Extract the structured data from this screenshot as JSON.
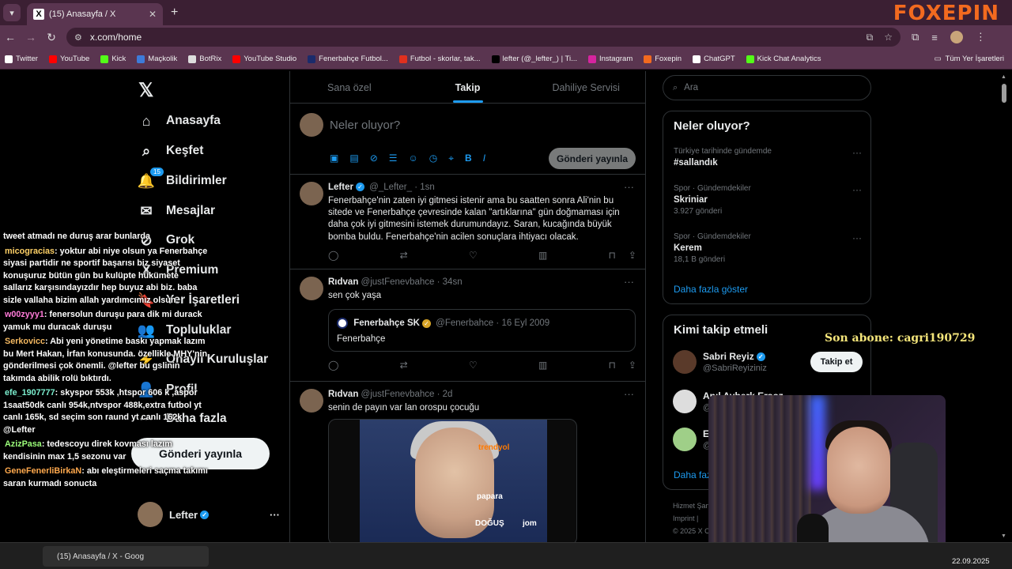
{
  "browser": {
    "tab_title": "(15) Anasayfa / X",
    "tab_close": "✕",
    "new_tab": "+",
    "url": "x.com/home",
    "brand": "FOXEPIN"
  },
  "bookmarks": [
    {
      "label": "Twitter",
      "color": "#ffffff"
    },
    {
      "label": "YouTube",
      "color": "#ff0000"
    },
    {
      "label": "Kick",
      "color": "#53fc18"
    },
    {
      "label": "Maçkolik",
      "color": "#3d7bd9"
    },
    {
      "label": "BotRix",
      "color": "#dddddd"
    },
    {
      "label": "YouTube Studio",
      "color": "#ff0000"
    },
    {
      "label": "Fenerbahçe Futbol...",
      "color": "#1b2b6b"
    },
    {
      "label": "Futbol - skorlar, tak...",
      "color": "#e0301e"
    },
    {
      "label": "lefter (@_lefter_) | Ti...",
      "color": "#000000"
    },
    {
      "label": "Instagram",
      "color": "#d6249f"
    },
    {
      "label": "Foxepin",
      "color": "#f26a1f"
    },
    {
      "label": "ChatGPT",
      "color": "#ffffff"
    },
    {
      "label": "Kick Chat Analytics",
      "color": "#53fc18"
    }
  ],
  "bookmarks_all": "Tüm Yer İşaretleri",
  "nav": {
    "items": [
      {
        "label": "Anasayfa",
        "icon": "⌂"
      },
      {
        "label": "Keşfet",
        "icon": "⌕"
      },
      {
        "label": "Bildirimler",
        "icon": "🔔",
        "badge": "15"
      },
      {
        "label": "Mesajlar",
        "icon": "✉"
      },
      {
        "label": "Grok",
        "icon": "⊘"
      },
      {
        "label": "Premium",
        "icon": "X"
      },
      {
        "label": "Yer İşaretleri",
        "icon": "🔖"
      },
      {
        "label": "Topluluklar",
        "icon": "👥"
      },
      {
        "label": "Onaylı Kuruluşlar",
        "icon": "⚡"
      },
      {
        "label": "Profil",
        "icon": "👤"
      },
      {
        "label": "Daha fazla",
        "icon": "⋯"
      }
    ],
    "post_button": "Gönderi yayınla",
    "account_name": "Lefter",
    "account_more": "···"
  },
  "feed": {
    "tabs": [
      "Sana özel",
      "Takip",
      "Dahiliye Servisi"
    ],
    "active_tab": 1,
    "compose_placeholder": "Neler oluyor?",
    "compose_button": "Gönderi yayınla",
    "tweets": [
      {
        "name": "Lefter",
        "handle": "@_Lefter_",
        "time": "1sn",
        "text": "Fenerbahçe'nin zaten iyi gitmesi istenir ama bu saatten sonra Ali'nin bu sitede ve Fenerbahçe çevresinde kalan \"artıklarına\" gün doğmaması için daha çok iyi gitmesini istemek durumundayız. Saran, kucağında büyük bomba buldu. Fenerbahçe'nin acilen sonuçlara ihtiyacı olacak."
      },
      {
        "name": "Rıdvan",
        "handle": "@justFenevbahce",
        "time": "34sn",
        "text": "sen çok yaşa",
        "quote": {
          "name": "Fenerbahçe SK",
          "handle": "@Fenerbahce",
          "time": "16 Eyl 2009",
          "text": "Fenerbahçe"
        }
      },
      {
        "name": "Rıdvan",
        "handle": "@justFenevbahce",
        "time": "2d",
        "text": "senin de payın var lan orospu çocuğu",
        "media_sponsors": [
          "trendyol",
          "papara",
          "DOĞUŞ",
          "jom"
        ]
      }
    ]
  },
  "sidebar": {
    "search_placeholder": "Ara",
    "trends_title": "Neler oluyor?",
    "trends": [
      {
        "context": "Türkiye tarihinde gündemde",
        "title": "#sallandık",
        "count": ""
      },
      {
        "context": "Spor · Gündemdekiler",
        "title": "Skriniar",
        "count": "3.927 gönderi"
      },
      {
        "context": "Spor · Gündemdekiler",
        "title": "Kerem",
        "count": "18,1 B gönderi"
      }
    ],
    "show_more": "Daha fazla göster",
    "who_title": "Kimi takip etmeli",
    "who": [
      {
        "name": "Sabri Reyiz",
        "handle": "@SabriReyiziniz",
        "button": "Takip et"
      },
      {
        "name": "Anıl Ayberk Ersoz",
        "handle": "@",
        "button": ""
      },
      {
        "name": "E",
        "handle": "@",
        "button": ""
      }
    ],
    "who_more": "Daha faz",
    "footer": [
      "Hizmet Şart",
      "Imprint |",
      "© 2025 X C"
    ]
  },
  "chat": [
    {
      "user": "",
      "color": "#ffffff",
      "text": "tweet atmadı ne duruş arar bunlarda"
    },
    {
      "user": "micogracias",
      "color": "#ffd166",
      "text": ": yoktur abi niye olsun ya Fenerbahçe siyasi partidir ne sportif başarısı biz siyaset konuşuruz bütün gün bu kulüpte hükümete sallarız karşısındayızdır hep buyuz abi biz. baba sizle vallaha bizim allah yardımcımız olsun."
    },
    {
      "user": "w00zyyy1",
      "color": "#ff7ad9",
      "text": ": fenersolun duruşu para dik mi durack yamuk mu duracak duruşu"
    },
    {
      "user": "Serkovicc",
      "color": "#f4b860",
      "text": ": Abi yeni yönetime baskı yapmak lazım bu Mert Hakan, İrfan konusunda. özellikle MHY'nin gönderilmesi çok önemli. @lefter bu gslinin takımda abilik rolü bıktırdı."
    },
    {
      "user": "efe_1907777",
      "color": "#7cf0d0",
      "text": ": skyspor 553k ,htspor 606 k ,aspor 1saat50dk canlı 954k,ntvspor 488k,extra futbol yt canlı 165k, sd seçim son raund yt canlı 162k @Lefter"
    },
    {
      "user": "AzizPasa",
      "color": "#9cff7a",
      "text": ": tedescoyu direk kovması lazım kendisinin max 1,5 sezonu var"
    },
    {
      "user": "GeneFenerliBirkaN",
      "color": "#ffa94d",
      "text": ": abı eleştirmeleri saçma takımı saran kurmadı sonucta"
    }
  ],
  "sub_alert": "Son abone: cagri190729",
  "taskbar": {
    "task": "(15) Anasayfa / X - Goog",
    "date": "22.09.2025"
  }
}
